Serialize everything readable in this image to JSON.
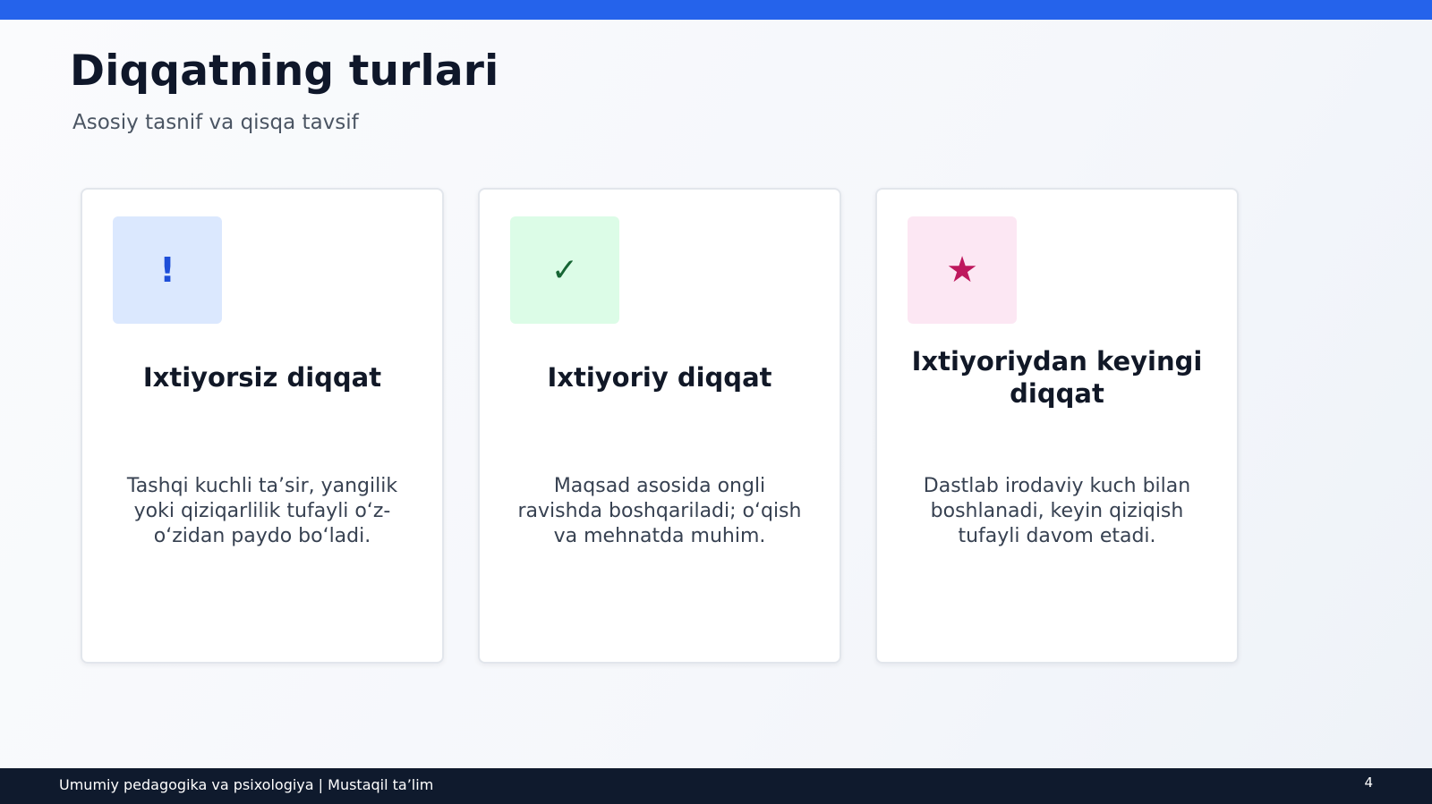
{
  "slide": {
    "title": "Diqqatning turlari",
    "subtitle": "Asosiy tasnif va qisqa tavsif",
    "accent_color": "#2563eb"
  },
  "cards": [
    {
      "icon": "exclamation-icon",
      "icon_glyph": "!",
      "icon_bg": "#dbe8fe",
      "icon_color": "#1d4ed8",
      "title": "Ixtiyorsiz diqqat",
      "description": "Tashqi kuchli ta’sir, yangilik yoki qiziqarlilik tufayli o‘z-o‘zidan paydo bo‘ladi."
    },
    {
      "icon": "checkmark-icon",
      "icon_glyph": "✓",
      "icon_bg": "#dcfce7",
      "icon_color": "#166534",
      "title": "Ixtiyoriy diqqat",
      "description": "Maqsad asosida ongli ravishda boshqariladi; o‘qish va mehnatda muhim."
    },
    {
      "icon": "star-icon",
      "icon_glyph": "★",
      "icon_bg": "#fce7f3",
      "icon_color": "#be185d",
      "title": "Ixtiyoriydan keyingi diqqat",
      "description": "Dastlab irodaviy kuch bilan boshlanadi, keyin qiziqish tufayli davom etadi."
    }
  ],
  "footer": {
    "text": "Umumiy pedagogika va psixologiya | Mustaqil ta’lim",
    "page_number": "4",
    "background": "#0f1a2d"
  }
}
